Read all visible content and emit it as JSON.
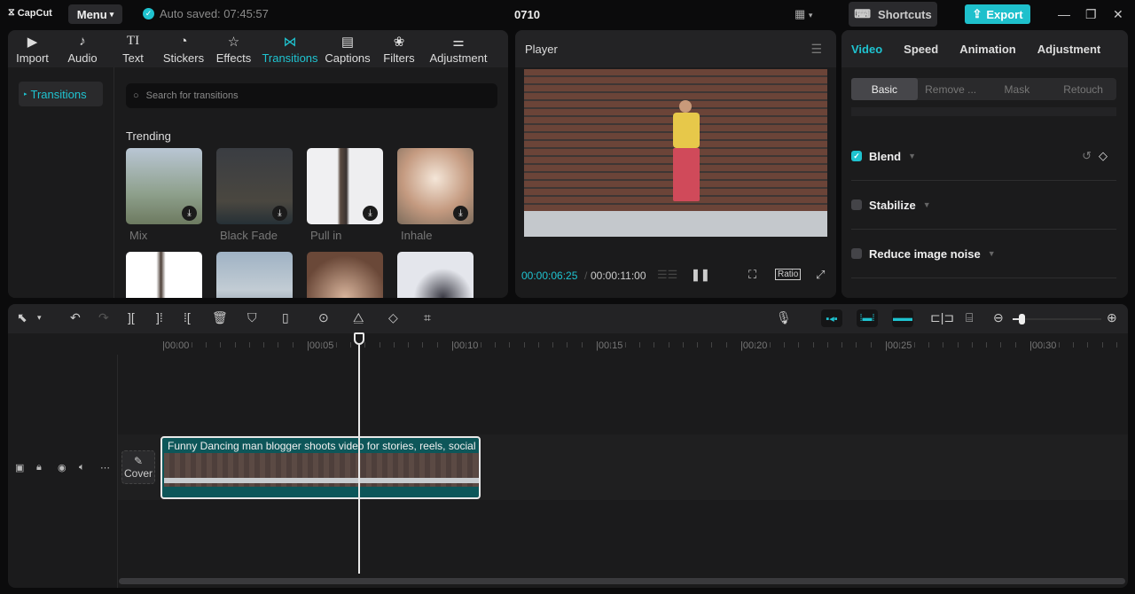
{
  "app": {
    "logo": "CapCut",
    "menu_label": "Menu",
    "autosave": "Auto saved: 07:45:57",
    "project_title": "0710",
    "shortcuts_label": "Shortcuts",
    "export_label": "Export",
    "accent": "#1fc3d0"
  },
  "media_tabs": [
    {
      "label": "Import",
      "icon": "import-icon"
    },
    {
      "label": "Audio",
      "icon": "audio-icon"
    },
    {
      "label": "Text",
      "icon": "text-icon"
    },
    {
      "label": "Stickers",
      "icon": "stickers-icon"
    },
    {
      "label": "Effects",
      "icon": "effects-icon"
    },
    {
      "label": "Transitions",
      "icon": "transitions-icon",
      "active": true
    },
    {
      "label": "Captions",
      "icon": "captions-icon"
    },
    {
      "label": "Filters",
      "icon": "filters-icon"
    },
    {
      "label": "Adjustment",
      "icon": "adjustment-icon"
    }
  ],
  "sidebar": {
    "items": [
      {
        "label": "Transitions",
        "active": true
      }
    ]
  },
  "search": {
    "placeholder": "Search for transitions"
  },
  "trending": {
    "title": "Trending",
    "items": [
      {
        "label": "Mix"
      },
      {
        "label": "Black Fade"
      },
      {
        "label": "Pull in"
      },
      {
        "label": "Inhale"
      },
      {
        "label": ""
      },
      {
        "label": ""
      },
      {
        "label": ""
      },
      {
        "label": ""
      }
    ]
  },
  "player": {
    "title": "Player",
    "current_time": "00:00:06:25",
    "total_time": "00:00:11:00",
    "ratio_label": "Ratio"
  },
  "inspector": {
    "tabs": [
      {
        "label": "Video",
        "active": true
      },
      {
        "label": "Speed"
      },
      {
        "label": "Animation"
      },
      {
        "label": "Adjustment"
      }
    ],
    "subtabs": [
      {
        "label": "Basic",
        "active": true
      },
      {
        "label": "Remove ..."
      },
      {
        "label": "Mask"
      },
      {
        "label": "Retouch"
      }
    ],
    "properties": [
      {
        "label": "Blend",
        "checked": true
      },
      {
        "label": "Stabilize",
        "checked": false
      },
      {
        "label": "Reduce image noise",
        "checked": false
      }
    ]
  },
  "timeline": {
    "ruler": [
      "00:00",
      "00:05",
      "00:10",
      "00:15",
      "00:20",
      "00:25",
      "00:30"
    ],
    "clip_title": "Funny Dancing man blogger shoots video for stories, reels, social m",
    "cover_label": "Cover",
    "zoom_level": 0.1
  }
}
